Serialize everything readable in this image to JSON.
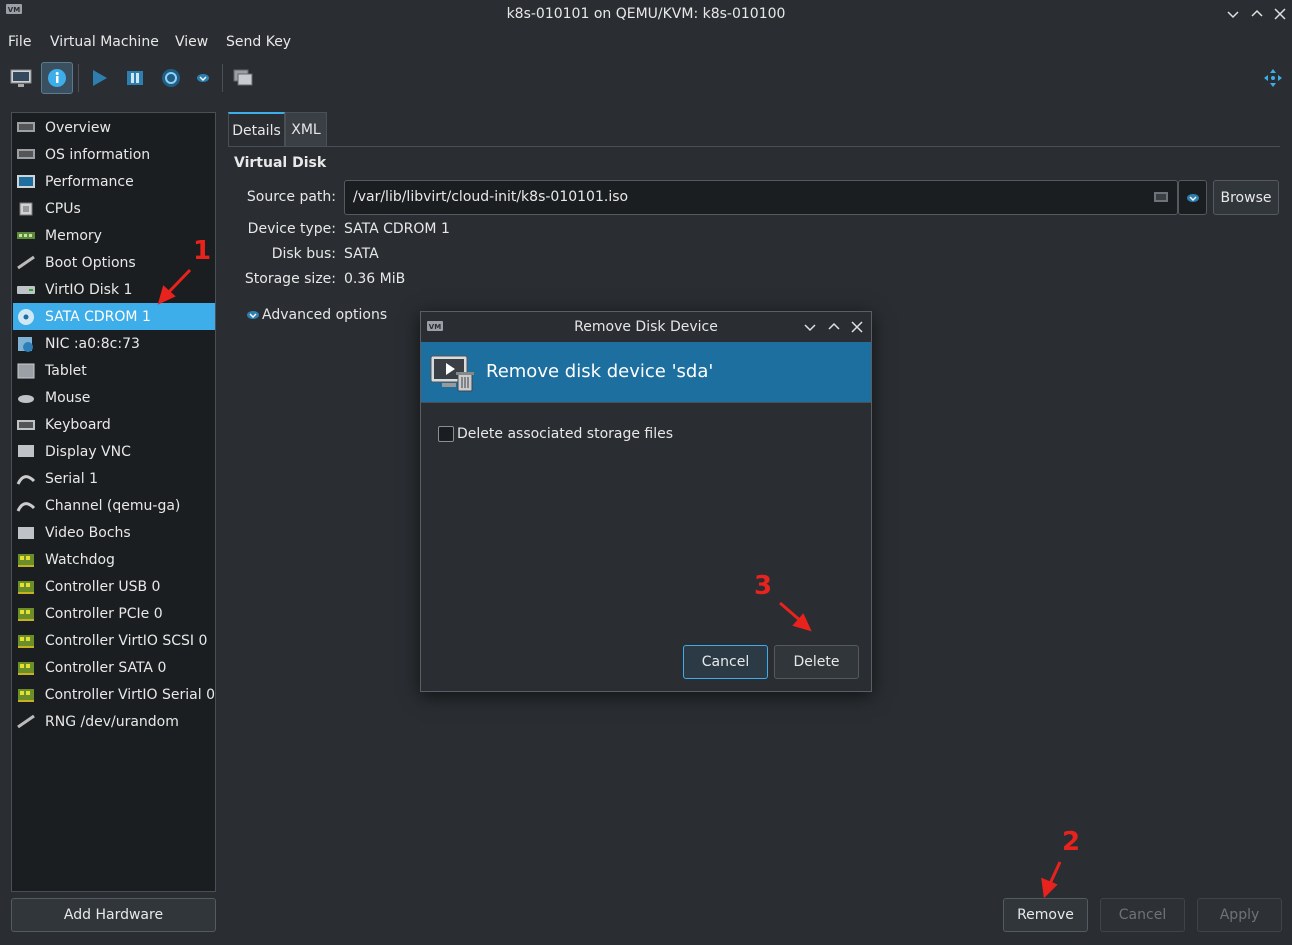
{
  "window": {
    "title": "k8s-010101 on QEMU/KVM: k8s-010100"
  },
  "menubar": {
    "items": [
      "File",
      "Virtual Machine",
      "View",
      "Send Key"
    ]
  },
  "sidebar": {
    "selected_index": 7,
    "items": [
      {
        "label": "Overview",
        "icon": "overview-icon"
      },
      {
        "label": "OS information",
        "icon": "os-icon"
      },
      {
        "label": "Performance",
        "icon": "performance-icon"
      },
      {
        "label": "CPUs",
        "icon": "cpu-icon"
      },
      {
        "label": "Memory",
        "icon": "memory-icon"
      },
      {
        "label": "Boot Options",
        "icon": "boot-icon"
      },
      {
        "label": "VirtIO Disk 1",
        "icon": "disk-icon"
      },
      {
        "label": "SATA CDROM 1",
        "icon": "cdrom-icon"
      },
      {
        "label": "NIC :a0:8c:73",
        "icon": "nic-icon"
      },
      {
        "label": "Tablet",
        "icon": "tablet-icon"
      },
      {
        "label": "Mouse",
        "icon": "mouse-icon"
      },
      {
        "label": "Keyboard",
        "icon": "keyboard-icon"
      },
      {
        "label": "Display VNC",
        "icon": "display-icon"
      },
      {
        "label": "Serial 1",
        "icon": "serial-icon"
      },
      {
        "label": "Channel (qemu-ga)",
        "icon": "channel-icon"
      },
      {
        "label": "Video Bochs",
        "icon": "video-icon"
      },
      {
        "label": "Watchdog",
        "icon": "pci-card-icon"
      },
      {
        "label": "Controller USB 0",
        "icon": "pci-card-icon"
      },
      {
        "label": "Controller PCIe 0",
        "icon": "pci-card-icon"
      },
      {
        "label": "Controller VirtIO SCSI 0",
        "icon": "pci-card-icon"
      },
      {
        "label": "Controller SATA 0",
        "icon": "pci-card-icon"
      },
      {
        "label": "Controller VirtIO Serial 0",
        "icon": "pci-card-icon"
      },
      {
        "label": "RNG /dev/urandom",
        "icon": "rng-icon"
      }
    ],
    "add_hardware": "Add Hardware"
  },
  "tabs": {
    "details": "Details",
    "xml": "XML"
  },
  "disk": {
    "section_title": "Virtual Disk",
    "source_path_label": "Source path:",
    "source_path": "/var/lib/libvirt/cloud-init/k8s-010101.iso",
    "browse": "Browse",
    "device_type_label": "Device type:",
    "device_type": "SATA CDROM 1",
    "disk_bus_label": "Disk bus:",
    "disk_bus": "SATA",
    "storage_size_label": "Storage size:",
    "storage_size": "0.36 MiB",
    "advanced": "Advanced options"
  },
  "footer": {
    "remove": "Remove",
    "cancel": "Cancel",
    "apply": "Apply"
  },
  "dialog": {
    "title": "Remove Disk Device",
    "header": "Remove disk device 'sda'",
    "checkbox_label": "Delete associated storage files",
    "checkbox_checked": false,
    "cancel": "Cancel",
    "delete": "Delete"
  },
  "annotations": {
    "a1": "1",
    "a2": "2",
    "a3": "3",
    "color": "#e8221c"
  },
  "colors": {
    "accent": "#3daee9",
    "dialog_header": "#1d6fa0",
    "background": "#2a2e32"
  }
}
